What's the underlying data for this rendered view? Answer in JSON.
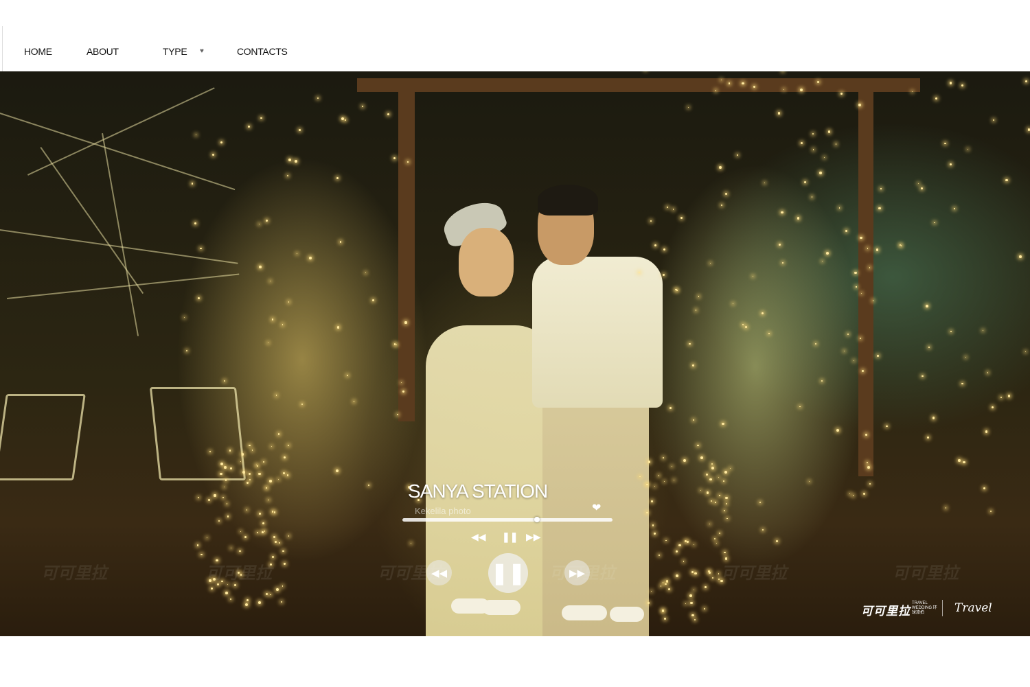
{
  "nav": {
    "items": [
      {
        "label": "HOME"
      },
      {
        "label": "ABOUT"
      },
      {
        "label": "TYPE"
      },
      {
        "label": "CONTACTS"
      }
    ],
    "type_dropdown_icon": "chevron-down-icon"
  },
  "player": {
    "title": "SANYA STATION",
    "subtitle": "Kekelila photo",
    "progress": 0.64,
    "icons": {
      "like": "heart-icon",
      "rewind_small": "rewind-icon",
      "pause_small": "pause-icon",
      "forward_small": "fast-forward-icon",
      "prev": "previous-icon",
      "play_pause": "pause-icon",
      "next": "next-icon"
    }
  },
  "branding": {
    "logo_text": "可可里拉",
    "logo_sub": "TRAVEL WEDDING 环球旅拍",
    "logo_b": "Travel",
    "watermark": "可可里拉"
  },
  "colors": {
    "nav_bg": "#ffffff",
    "nav_text": "#111111",
    "player_text": "#ffffff"
  }
}
